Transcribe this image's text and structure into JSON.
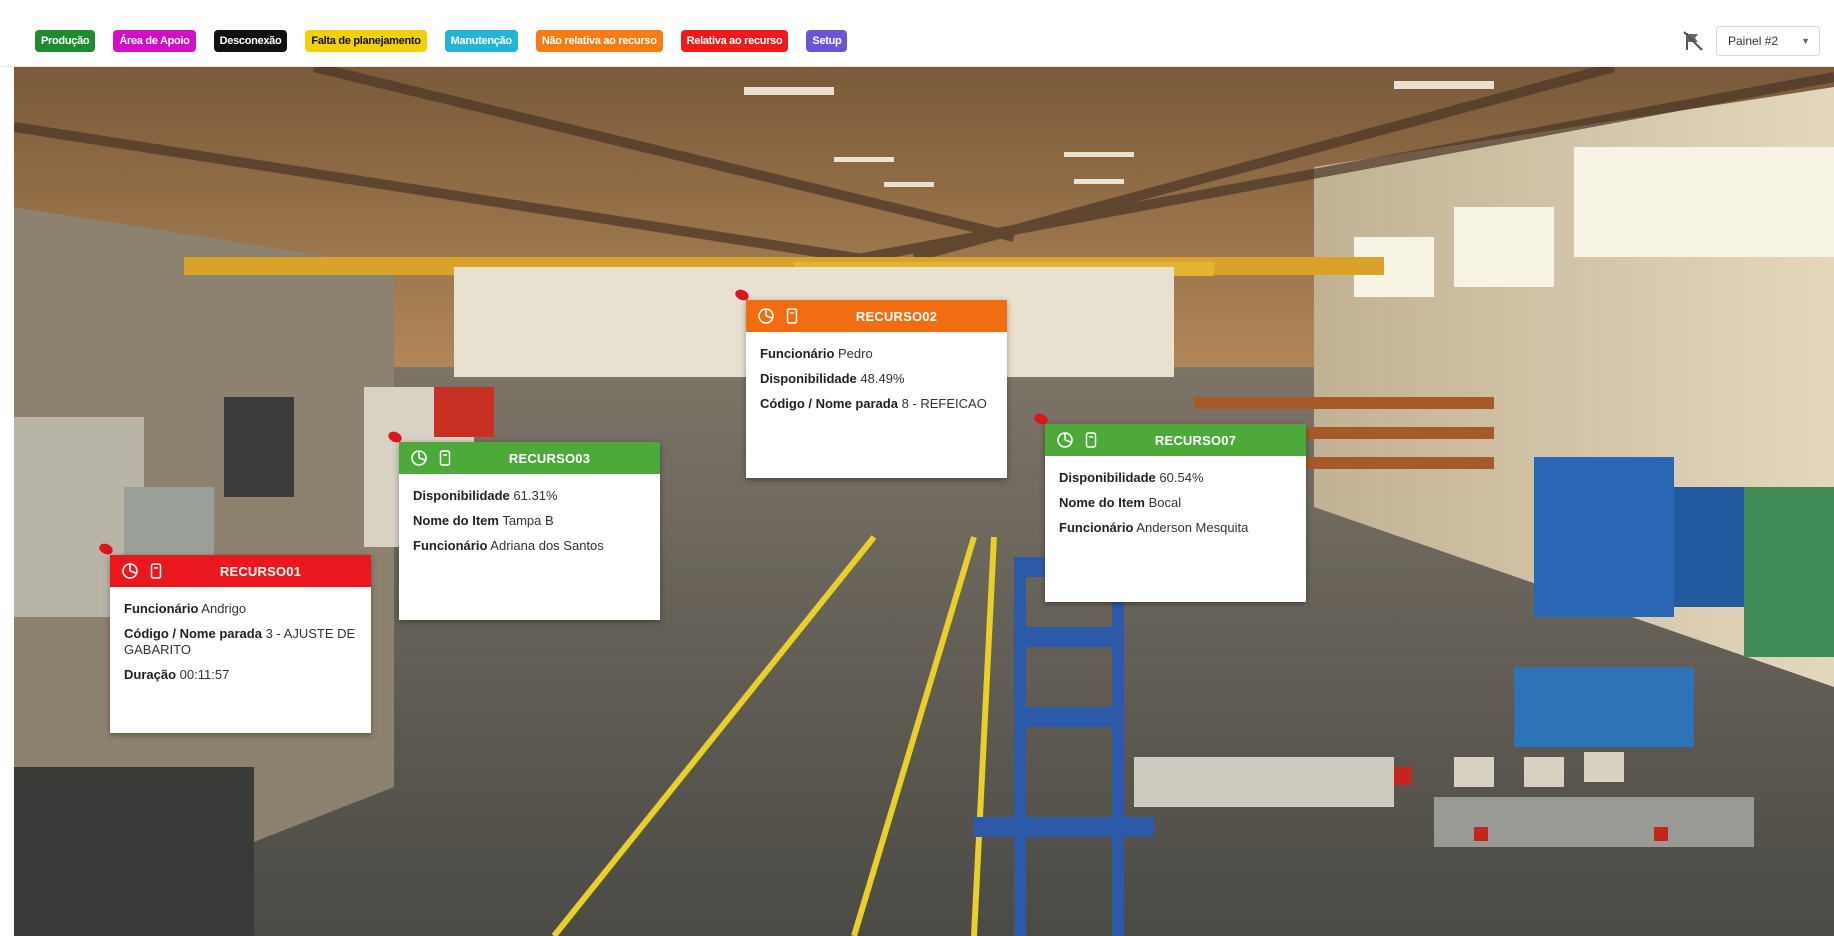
{
  "legend": [
    {
      "label": "Produção",
      "color": "#1e8c2e"
    },
    {
      "label": "Área de Apoio",
      "color": "#d10fc5"
    },
    {
      "label": "Desconexão",
      "color": "#111111"
    },
    {
      "label": "Falta de planejamento",
      "color": "#f2d10a"
    },
    {
      "label": "Manutenção",
      "color": "#22b3d6"
    },
    {
      "label": "Não relativa ao recurso",
      "color": "#f57c13"
    },
    {
      "label": "Relativa ao recurso",
      "color": "#ec1c1c"
    },
    {
      "label": "Setup",
      "color": "#6b55d6"
    }
  ],
  "toolbar": {
    "panel_selected": "Painel #2",
    "flag_icon": "flag-off-icon"
  },
  "cards": [
    {
      "title": "RECURSO01",
      "color": "#e8181e",
      "rows": [
        {
          "label": "Funcionário",
          "value": "Andrigo"
        },
        {
          "label": "Código / Nome parada",
          "value": "3 - AJUSTE DE GABARITO"
        },
        {
          "label": "Duração",
          "value": "00:11:57"
        }
      ]
    },
    {
      "title": "RECURSO03",
      "color": "#4ea93b",
      "rows": [
        {
          "label": "Disponibilidade",
          "value": "61.31%"
        },
        {
          "label": "Nome do Item",
          "value": "Tampa B"
        },
        {
          "label": "Funcionário",
          "value": "Adriana dos Santos"
        }
      ]
    },
    {
      "title": "RECURSO02",
      "color": "#f26c11",
      "rows": [
        {
          "label": "Funcionário",
          "value": "Pedro"
        },
        {
          "label": "Disponibilidade",
          "value": "48.49%"
        },
        {
          "label": "Código / Nome parada",
          "value": "8 - REFEICAO"
        }
      ]
    },
    {
      "title": "RECURSO07",
      "color": "#4ea93b",
      "rows": [
        {
          "label": "Disponibilidade",
          "value": "60.54%"
        },
        {
          "label": "Nome do Item",
          "value": "Bocal"
        },
        {
          "label": "Funcionário",
          "value": "Anderson Mesquita"
        }
      ]
    }
  ]
}
